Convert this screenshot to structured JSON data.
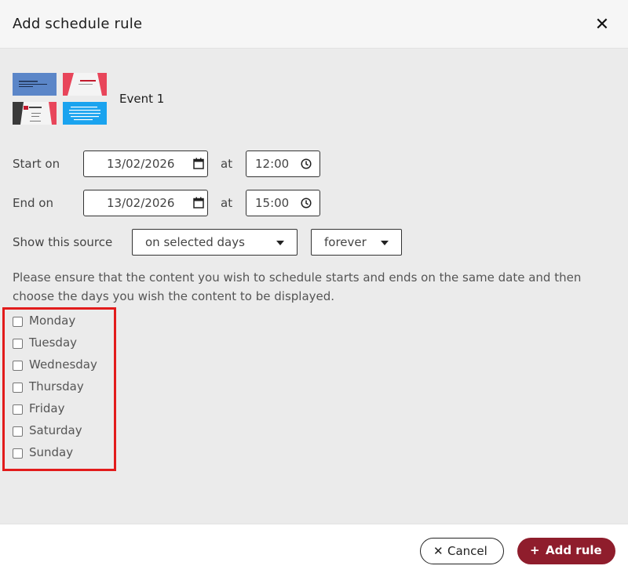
{
  "dialog": {
    "title": "Add schedule rule",
    "close_icon": "close-icon"
  },
  "event": {
    "name": "Event 1",
    "thumbnails": [
      "thumbnail-1",
      "thumbnail-2",
      "thumbnail-3",
      "thumbnail-4"
    ]
  },
  "start": {
    "label": "Start on",
    "date": "13/02/2026",
    "at": "at",
    "time": "12:00"
  },
  "end": {
    "label": "End on",
    "date": "13/02/2026",
    "at": "at",
    "time": "15:00"
  },
  "source": {
    "label": "Show this source",
    "mode": "on selected days",
    "duration": "forever"
  },
  "info_text": "Please ensure that the content you wish to schedule starts and ends on the same date and then choose the days you wish the content to be displayed.",
  "days": [
    "Monday",
    "Tuesday",
    "Wednesday",
    "Thursday",
    "Friday",
    "Saturday",
    "Sunday"
  ],
  "footer": {
    "cancel_label": "Cancel",
    "add_label": "Add rule"
  },
  "colors": {
    "accent": "#8f1d2c",
    "highlight_border": "#e21b1b",
    "body_bg": "#ebebeb"
  }
}
